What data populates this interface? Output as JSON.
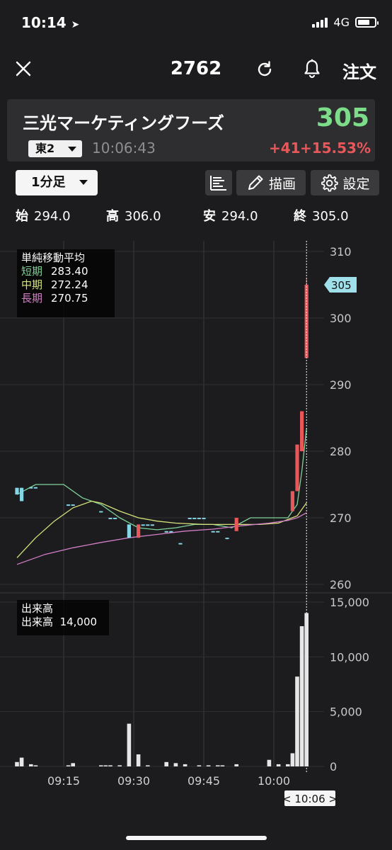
{
  "status": {
    "time": "10:14",
    "network": "4G"
  },
  "nav": {
    "title": "2762",
    "order_label": "注文"
  },
  "stock": {
    "name": "三光マーケティングフーズ",
    "price": "305",
    "market": "東2",
    "time": "10:06:43",
    "change": "+41",
    "change_pct": "+15.53%"
  },
  "toolbar": {
    "timeframe": "1分足",
    "draw_label": "描画",
    "settings_label": "設定"
  },
  "ohlc": {
    "open_label": "始",
    "open": "294.0",
    "high_label": "高",
    "high": "306.0",
    "low_label": "安",
    "low": "294.0",
    "close_label": "終",
    "close": "305.0"
  },
  "colors": {
    "up": "#e8575a",
    "down": "#86d7e6",
    "ma_short": "#7fd39a",
    "ma_mid": "#d6e27a",
    "ma_long": "#d27fc8",
    "price_tag": "#9fe0ea",
    "price_green": "#7ddc8a"
  },
  "chart_data": [
    {
      "type": "candlestick",
      "title": "単純移動平均",
      "legend": [
        {
          "name": "短期",
          "value": "283.40"
        },
        {
          "name": "中期",
          "value": "272.24"
        },
        {
          "name": "長期",
          "value": "270.75"
        }
      ],
      "y_ticks": [
        "310",
        "300",
        "290",
        "280",
        "270",
        "260"
      ],
      "ylim": [
        260,
        310
      ],
      "last_price_tag": "305",
      "x_ticks": [
        "09:15",
        "09:30",
        "09:45",
        "10:00"
      ],
      "cursor_label": "< 10:06 >",
      "candles": [
        {
          "i": 0,
          "o": 274.5,
          "h": 274.5,
          "l": 273.5,
          "c": 273.5
        },
        {
          "i": 1,
          "o": 274.5,
          "h": 274.5,
          "l": 272.5,
          "c": 272.5
        },
        {
          "i": 3,
          "o": 274.6,
          "h": 274.6,
          "l": 274.4,
          "c": 274.4
        },
        {
          "i": 4,
          "o": 274.6,
          "h": 274.6,
          "l": 274.4,
          "c": 274.4
        },
        {
          "i": 11,
          "o": 272.0,
          "h": 272.0,
          "l": 271.8,
          "c": 271.8
        },
        {
          "i": 12,
          "o": 272.0,
          "h": 272.0,
          "l": 271.8,
          "c": 271.8
        },
        {
          "i": 18,
          "o": 271.0,
          "h": 271.0,
          "l": 270.8,
          "c": 270.8
        },
        {
          "i": 20,
          "o": 270.0,
          "h": 270.0,
          "l": 269.8,
          "c": 269.8
        },
        {
          "i": 21,
          "o": 270.0,
          "h": 270.0,
          "l": 269.8,
          "c": 269.8
        },
        {
          "i": 24,
          "o": 269.0,
          "h": 269.0,
          "l": 267.0,
          "c": 267.0
        },
        {
          "i": 26,
          "o": 267.0,
          "h": 269.0,
          "l": 267.0,
          "c": 269.0
        },
        {
          "i": 27,
          "o": 269.0,
          "h": 269.0,
          "l": 268.8,
          "c": 268.8
        },
        {
          "i": 28,
          "o": 269.0,
          "h": 269.0,
          "l": 268.8,
          "c": 268.8
        },
        {
          "i": 29,
          "o": 269.0,
          "h": 269.0,
          "l": 268.8,
          "c": 268.8
        },
        {
          "i": 32,
          "o": 268.0,
          "h": 268.0,
          "l": 267.8,
          "c": 267.8
        },
        {
          "i": 33,
          "o": 268.0,
          "h": 268.0,
          "l": 267.8,
          "c": 267.8
        },
        {
          "i": 35,
          "o": 266.2,
          "h": 266.2,
          "l": 266.0,
          "c": 266.0
        },
        {
          "i": 37,
          "o": 270.0,
          "h": 270.0,
          "l": 269.8,
          "c": 269.8
        },
        {
          "i": 38,
          "o": 270.0,
          "h": 270.0,
          "l": 269.8,
          "c": 269.8
        },
        {
          "i": 39,
          "o": 270.0,
          "h": 270.0,
          "l": 269.8,
          "c": 269.8
        },
        {
          "i": 40,
          "o": 270.0,
          "h": 270.0,
          "l": 269.8,
          "c": 269.8
        },
        {
          "i": 42,
          "o": 268.0,
          "h": 268.0,
          "l": 267.8,
          "c": 267.8
        },
        {
          "i": 43,
          "o": 268.0,
          "h": 268.0,
          "l": 267.8,
          "c": 267.8
        },
        {
          "i": 45,
          "o": 267.0,
          "h": 267.0,
          "l": 266.8,
          "c": 266.8
        },
        {
          "i": 47,
          "o": 268.0,
          "h": 270.0,
          "l": 268.0,
          "c": 270.0
        },
        {
          "i": 59,
          "o": 271.0,
          "h": 274.0,
          "l": 271.0,
          "c": 274.0
        },
        {
          "i": 60,
          "o": 274.0,
          "h": 281.0,
          "l": 274.0,
          "c": 281.0
        },
        {
          "i": 61,
          "o": 280.0,
          "h": 286.0,
          "l": 280.0,
          "c": 286.0
        },
        {
          "i": 62,
          "o": 294.0,
          "h": 306.0,
          "l": 294.0,
          "c": 305.0
        }
      ],
      "moving_averages": {
        "short": [
          [
            0,
            273.5
          ],
          [
            4,
            275
          ],
          [
            10,
            275
          ],
          [
            14,
            273
          ],
          [
            18,
            272
          ],
          [
            22,
            270
          ],
          [
            26,
            268.5
          ],
          [
            30,
            268.2
          ],
          [
            34,
            268.5
          ],
          [
            38,
            269
          ],
          [
            42,
            269
          ],
          [
            46,
            268.5
          ],
          [
            50,
            270
          ],
          [
            54,
            270
          ],
          [
            58,
            270
          ],
          [
            60,
            272
          ],
          [
            61,
            277
          ],
          [
            62,
            283.4
          ]
        ],
        "mid": [
          [
            0,
            264
          ],
          [
            4,
            267
          ],
          [
            8,
            269.5
          ],
          [
            12,
            271.5
          ],
          [
            16,
            272.5
          ],
          [
            18,
            272.2
          ],
          [
            22,
            271
          ],
          [
            26,
            270
          ],
          [
            30,
            269.5
          ],
          [
            34,
            269.2
          ],
          [
            40,
            269
          ],
          [
            46,
            269
          ],
          [
            52,
            269
          ],
          [
            56,
            269.2
          ],
          [
            60,
            270.3
          ],
          [
            62,
            272.24
          ]
        ],
        "long": [
          [
            0,
            263
          ],
          [
            6,
            264.5
          ],
          [
            12,
            265.5
          ],
          [
            18,
            266.3
          ],
          [
            24,
            267
          ],
          [
            30,
            267.5
          ],
          [
            36,
            268
          ],
          [
            42,
            268.3
          ],
          [
            48,
            268.8
          ],
          [
            54,
            269.2
          ],
          [
            58,
            269.6
          ],
          [
            60,
            270
          ],
          [
            62,
            270.75
          ]
        ]
      }
    },
    {
      "type": "bar",
      "title": "出来高",
      "legend": [
        {
          "name": "出来高",
          "value": "14,000"
        }
      ],
      "y_ticks": [
        "15,000",
        "10,000",
        "5,000",
        "0"
      ],
      "ylim": [
        0,
        15000
      ],
      "volumes": [
        {
          "i": 0,
          "v": 400
        },
        {
          "i": 1,
          "v": 800
        },
        {
          "i": 3,
          "v": 200
        },
        {
          "i": 4,
          "v": 100
        },
        {
          "i": 11,
          "v": 100
        },
        {
          "i": 12,
          "v": 300
        },
        {
          "i": 18,
          "v": 100
        },
        {
          "i": 19,
          "v": 100
        },
        {
          "i": 20,
          "v": 100
        },
        {
          "i": 22,
          "v": 100
        },
        {
          "i": 24,
          "v": 3900
        },
        {
          "i": 26,
          "v": 1100
        },
        {
          "i": 28,
          "v": 100
        },
        {
          "i": 32,
          "v": 400
        },
        {
          "i": 34,
          "v": 300
        },
        {
          "i": 36,
          "v": 200
        },
        {
          "i": 39,
          "v": 100
        },
        {
          "i": 41,
          "v": 100
        },
        {
          "i": 43,
          "v": 100
        },
        {
          "i": 44,
          "v": 100
        },
        {
          "i": 47,
          "v": 200
        },
        {
          "i": 54,
          "v": 600
        },
        {
          "i": 56,
          "v": 200
        },
        {
          "i": 58,
          "v": 200
        },
        {
          "i": 59,
          "v": 1200
        },
        {
          "i": 60,
          "v": 8200
        },
        {
          "i": 61,
          "v": 12800
        },
        {
          "i": 62,
          "v": 14000
        }
      ]
    }
  ]
}
